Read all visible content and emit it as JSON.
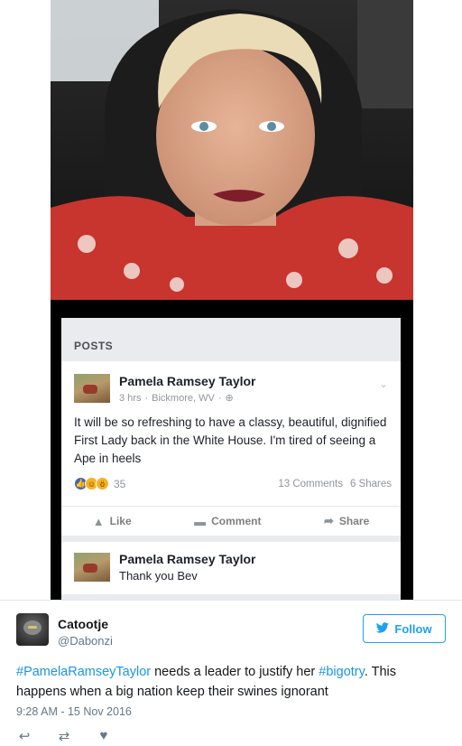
{
  "facebook_post": {
    "section_header": "POSTS",
    "author": "Pamela Ramsey Taylor",
    "time": "3 hrs",
    "location": "Bickmore, WV",
    "privacy_icon": "globe-icon",
    "text": "It will be so refreshing to have a classy, beautiful, dignified First Lady back in the White House. I'm tired of seeing a Ape in heels",
    "reaction_count": "35",
    "reaction_icons": [
      "like-icon",
      "haha-icon",
      "wow-icon"
    ],
    "comments": "13 Comments",
    "shares": "6 Shares",
    "actions": [
      {
        "label": "Like",
        "icon": "thumbs-up-icon"
      },
      {
        "label": "Comment",
        "icon": "comment-icon"
      },
      {
        "label": "Share",
        "icon": "share-arrow-icon"
      }
    ],
    "comment": {
      "author": "Pamela Ramsey Taylor",
      "text": "Thank you Bev"
    }
  },
  "tweet": {
    "display_name": "Catootje",
    "handle": "@Dabonzi",
    "follow_label": "Follow",
    "text_parts": {
      "hashtag1": "#PamelaRamseyTaylor",
      "text1": " needs a leader to justify her ",
      "hashtag2": "#bigotry",
      "text2": ". This happens when a big nation keep their swines ignorant"
    },
    "timestamp": "9:28 AM - 15 Nov 2016",
    "actions": [
      "reply-icon",
      "retweet-icon",
      "like-heart-icon"
    ]
  },
  "colors": {
    "twitter_blue": "#1da1f2",
    "hashtag": "#1b95e0",
    "facebook_blue": "#4267b2"
  }
}
